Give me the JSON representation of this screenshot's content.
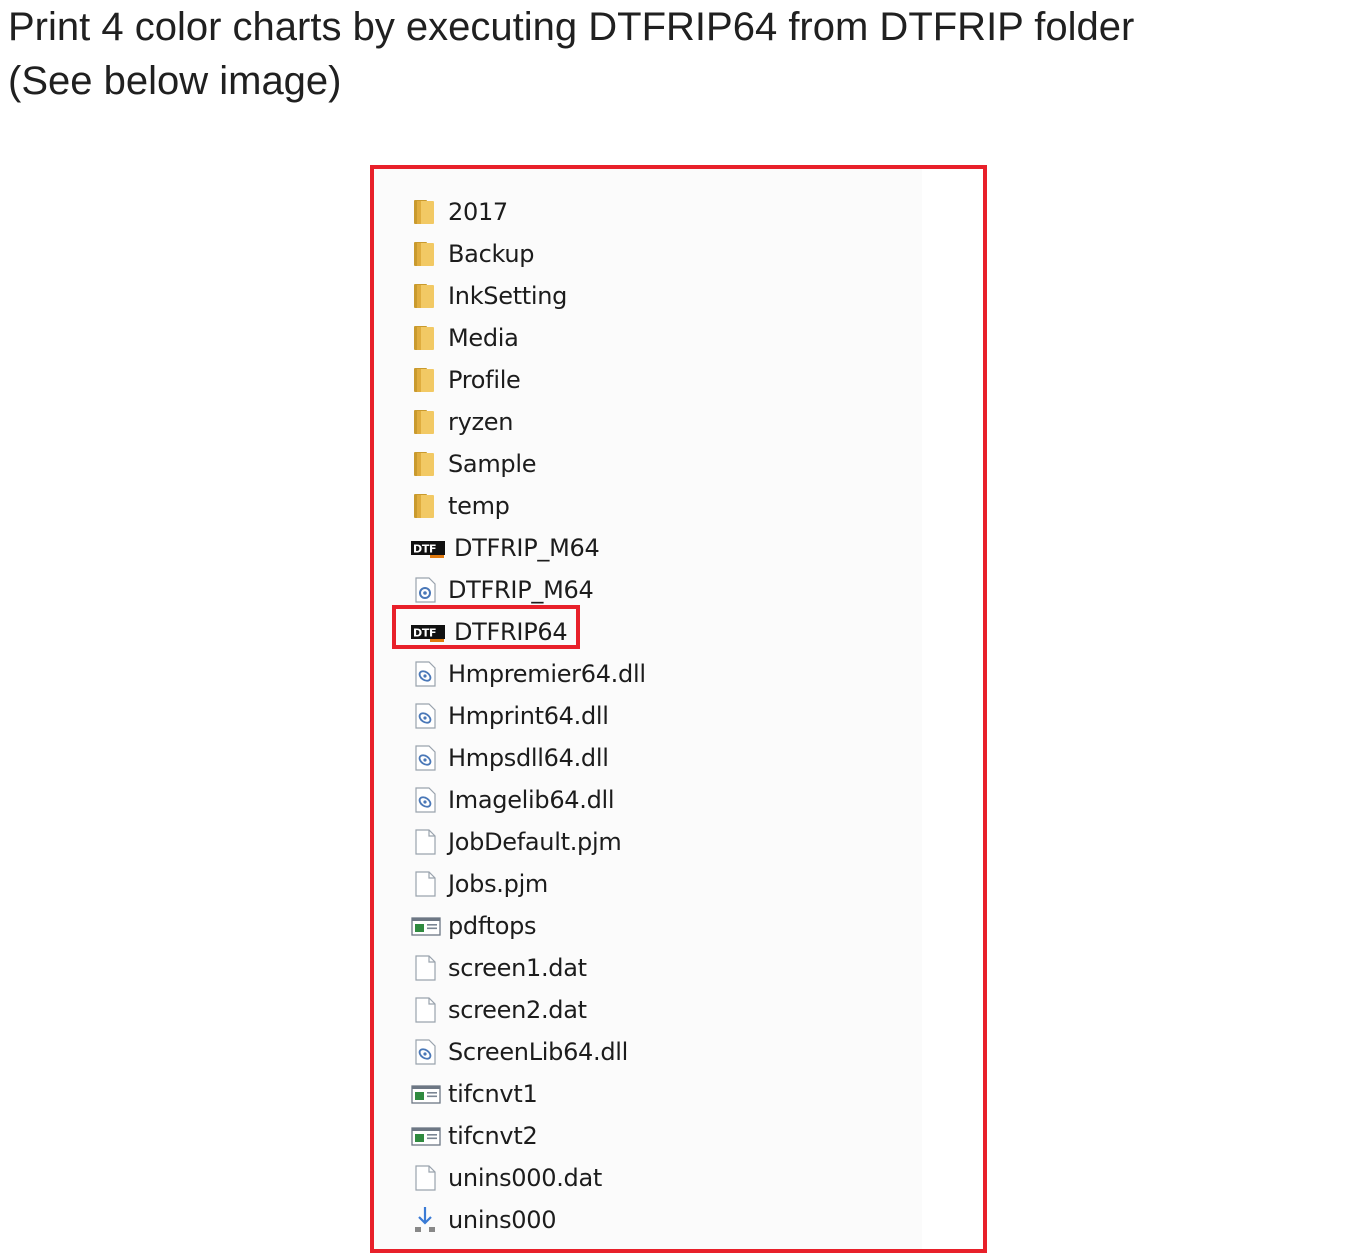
{
  "instruction": {
    "line1": "Print 4 color charts by executing DTFRIP64 from DTFRIP folder",
    "line2": "(See below image)"
  },
  "highlight_color": "#e8202a",
  "files": [
    {
      "name": "2017",
      "icon": "folder-icon"
    },
    {
      "name": "Backup",
      "icon": "folder-icon"
    },
    {
      "name": "InkSetting",
      "icon": "folder-icon"
    },
    {
      "name": "Media",
      "icon": "folder-icon"
    },
    {
      "name": "Profile",
      "icon": "folder-icon"
    },
    {
      "name": "ryzen",
      "icon": "folder-icon"
    },
    {
      "name": "Sample",
      "icon": "folder-icon"
    },
    {
      "name": "temp",
      "icon": "folder-icon"
    },
    {
      "name": "DTFRIP_M64",
      "icon": "dtf-app-icon"
    },
    {
      "name": "DTFRIP_M64",
      "icon": "config-file-icon"
    },
    {
      "name": "DTFRIP64",
      "icon": "dtf-app-icon",
      "highlighted": true
    },
    {
      "name": "Hmpremier64.dll",
      "icon": "dll-file-icon"
    },
    {
      "name": "Hmprint64.dll",
      "icon": "dll-file-icon"
    },
    {
      "name": "Hmpsdll64.dll",
      "icon": "dll-file-icon"
    },
    {
      "name": "Imagelib64.dll",
      "icon": "dll-file-icon"
    },
    {
      "name": "JobDefault.pjm",
      "icon": "blank-file-icon"
    },
    {
      "name": "Jobs.pjm",
      "icon": "blank-file-icon"
    },
    {
      "name": "pdftops",
      "icon": "exe-window-icon"
    },
    {
      "name": "screen1.dat",
      "icon": "blank-file-icon"
    },
    {
      "name": "screen2.dat",
      "icon": "blank-file-icon"
    },
    {
      "name": "ScreenLib64.dll",
      "icon": "dll-file-icon"
    },
    {
      "name": "tifcnvt1",
      "icon": "exe-window-icon"
    },
    {
      "name": "tifcnvt2",
      "icon": "exe-window-icon"
    },
    {
      "name": "unins000.dat",
      "icon": "blank-file-icon"
    },
    {
      "name": "unins000",
      "icon": "uninstall-icon"
    }
  ]
}
